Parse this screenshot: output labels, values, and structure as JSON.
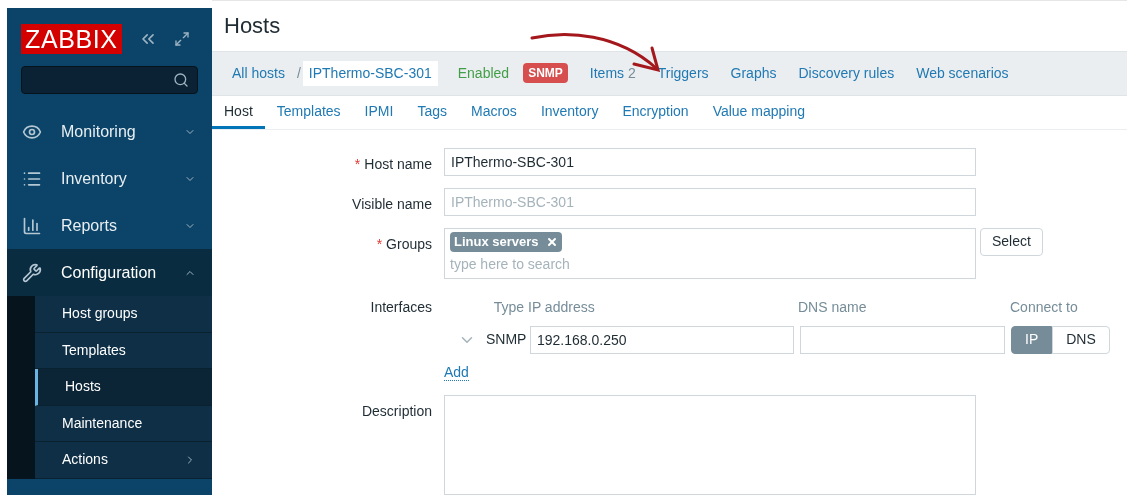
{
  "sidebar": {
    "logo": "ZABBIX",
    "menu": [
      {
        "label": "Monitoring",
        "expanded": false
      },
      {
        "label": "Inventory",
        "expanded": false
      },
      {
        "label": "Reports",
        "expanded": false
      },
      {
        "label": "Configuration",
        "expanded": true,
        "children": [
          {
            "label": "Host groups",
            "selected": false,
            "has_submenu": false
          },
          {
            "label": "Templates",
            "selected": false,
            "has_submenu": false
          },
          {
            "label": "Hosts",
            "selected": true,
            "has_submenu": false
          },
          {
            "label": "Maintenance",
            "selected": false,
            "has_submenu": false
          },
          {
            "label": "Actions",
            "selected": false,
            "has_submenu": true
          }
        ]
      }
    ]
  },
  "page_title": "Hosts",
  "host_nav": {
    "breadcrumb": [
      "All hosts",
      "IPThermo-SBC-301"
    ],
    "separator": "/",
    "status": "Enabled",
    "badge": "SNMP",
    "links": [
      {
        "label": "Items",
        "count": "2"
      },
      {
        "label": "Triggers"
      },
      {
        "label": "Graphs"
      },
      {
        "label": "Discovery rules"
      },
      {
        "label": "Web scenarios"
      }
    ]
  },
  "tabs": [
    {
      "label": "Host",
      "selected": true
    },
    {
      "label": "Templates",
      "selected": false
    },
    {
      "label": "IPMI",
      "selected": false
    },
    {
      "label": "Tags",
      "selected": false
    },
    {
      "label": "Macros",
      "selected": false
    },
    {
      "label": "Inventory",
      "selected": false
    },
    {
      "label": "Encryption",
      "selected": false
    },
    {
      "label": "Value mapping",
      "selected": false
    }
  ],
  "form": {
    "host_name": {
      "label": "Host name",
      "required_mark": "*",
      "value": "IPThermo-SBC-301"
    },
    "visible_name": {
      "label": "Visible name",
      "placeholder": "IPThermo-SBC-301"
    },
    "groups": {
      "label": "Groups",
      "required_mark": "*",
      "tags": [
        "Linux servers"
      ],
      "placeholder": "type here to search",
      "button": "Select"
    },
    "interfaces": {
      "label": "Interfaces",
      "columns": [
        "Type",
        "IP address",
        "DNS name",
        "Connect to"
      ],
      "rows": [
        {
          "expanded": false,
          "type": "SNMP",
          "ip": "192.168.0.250",
          "connect": [
            {
              "label": "IP",
              "selected": true
            },
            {
              "label": "DNS",
              "selected": false
            }
          ]
        }
      ],
      "add": "Add"
    },
    "description": {
      "label": "Description"
    }
  }
}
